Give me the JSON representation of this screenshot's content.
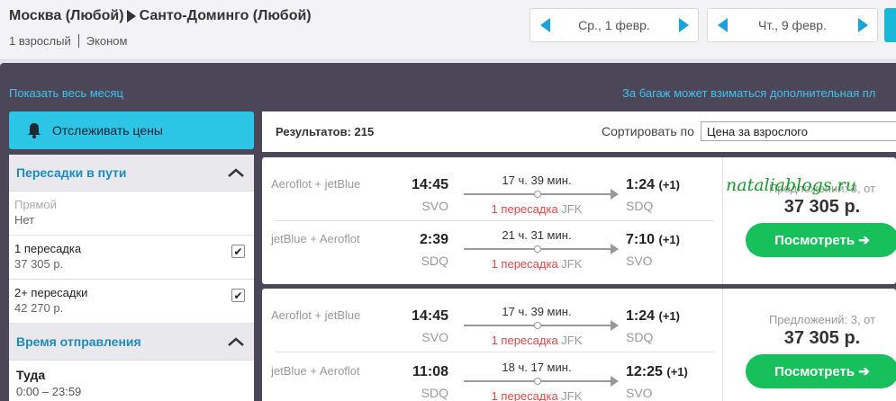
{
  "header": {
    "origin": "Москва (Любой)",
    "destination": "Санто-Доминго (Любой)",
    "passengers": "1 взрослый",
    "cabin": "Эконом",
    "depart_date": "Ср., 1 февр.",
    "return_date": "Чт., 9 февр."
  },
  "links": {
    "show_month": "Показать весь месяц",
    "baggage_note": "За багаж может взиматься дополнительная пл"
  },
  "sidebar": {
    "track_label": "Отслеживать цены",
    "stops_title": "Пересадки в пути",
    "stops": [
      {
        "label": "Прямой",
        "value": "Нет",
        "checked": false,
        "disabled": true
      },
      {
        "label": "1 пересадка",
        "value": "37 305 р.",
        "checked": true
      },
      {
        "label": "2+ пересадки",
        "value": "42 270 р.",
        "checked": true
      }
    ],
    "departure_title": "Время отправления",
    "departure_leg": "Туда",
    "departure_range": "0:00 – 23:59"
  },
  "results": {
    "count_label": "Результатов: 215",
    "sort_label": "Сортировать по",
    "sort_value": "Цена за взрослого"
  },
  "cards": [
    {
      "legs": [
        {
          "airline": "Aeroflot + jetBlue",
          "dep_time": "14:45",
          "dep_code": "SVO",
          "duration": "17 ч. 39 мин.",
          "stops": "1 пересадка",
          "via": "JFK",
          "arr_time": "1:24",
          "arr_plus": "(+1)",
          "arr_code": "SDQ"
        },
        {
          "airline": "jetBlue + Aeroflot",
          "dep_time": "2:39",
          "dep_code": "SDQ",
          "duration": "21 ч. 31 мин.",
          "stops": "1 пересадка",
          "via": "JFK",
          "arr_time": "7:10",
          "arr_plus": "(+1)",
          "arr_code": "SVO"
        }
      ],
      "offers": "Предложений: 3, от",
      "price": "37 305 р.",
      "button": "Посмотреть ➔"
    },
    {
      "legs": [
        {
          "airline": "Aeroflot + jetBlue",
          "dep_time": "14:45",
          "dep_code": "SVO",
          "duration": "17 ч. 39 мин.",
          "stops": "1 пересадка",
          "via": "JFK",
          "arr_time": "1:24",
          "arr_plus": "(+1)",
          "arr_code": "SDQ"
        },
        {
          "airline": "jetBlue + Aeroflot",
          "dep_time": "11:08",
          "dep_code": "SDQ",
          "duration": "18 ч. 17 мин.",
          "stops": "1 пересадка",
          "via": "JFK",
          "arr_time": "12:25",
          "arr_plus": "(+1)",
          "arr_code": "SVO"
        }
      ],
      "offers": "Предложений: 3, от",
      "price": "37 305 р.",
      "button": "Посмотреть ➔"
    }
  ],
  "watermark": "nataliablogs.ru",
  "colors": {
    "accent": "#1aa3d8",
    "button_green": "#17c05a",
    "band": "#4b4758",
    "stops_red": "#e04848"
  }
}
